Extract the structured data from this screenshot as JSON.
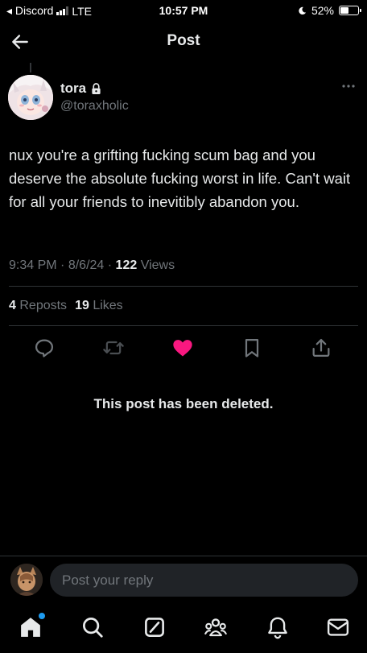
{
  "status_bar": {
    "carrier": "◂ Discord",
    "network": "LTE",
    "time": "10:57 PM",
    "battery": "52%",
    "battery_level": 0.52
  },
  "header": {
    "title": "Post"
  },
  "post": {
    "author": {
      "name": "tora",
      "handle": "@toraxholic"
    },
    "text": "nux you're a grifting fucking scum bag and you deserve the absolute fucking worst in life. Can't wait for all your friends to inevitibly abandon you.",
    "time": "9:34 PM",
    "date": "8/6/24",
    "sep": "·",
    "views_count": "122",
    "views_label": "Views",
    "reposts_count": "4",
    "reposts_label": "Reposts",
    "likes_count": "19",
    "likes_label": "Likes"
  },
  "deleted_message": "This post has been deleted.",
  "reply": {
    "placeholder": "Post your reply"
  },
  "colors": {
    "background": "#000000",
    "like": "#f91880",
    "muted": "#71767b",
    "accent": "#1d9bf0"
  },
  "icons": {
    "back": "arrow-left-icon",
    "lock": "lock-icon",
    "more": "more-icon",
    "reply": "reply-icon",
    "repost": "repost-icon",
    "like": "heart-icon",
    "bookmark": "bookmark-icon",
    "share": "share-icon",
    "tabs": [
      "home-icon",
      "search-icon",
      "grok-icon",
      "communities-icon",
      "notifications-icon",
      "messages-icon"
    ]
  }
}
